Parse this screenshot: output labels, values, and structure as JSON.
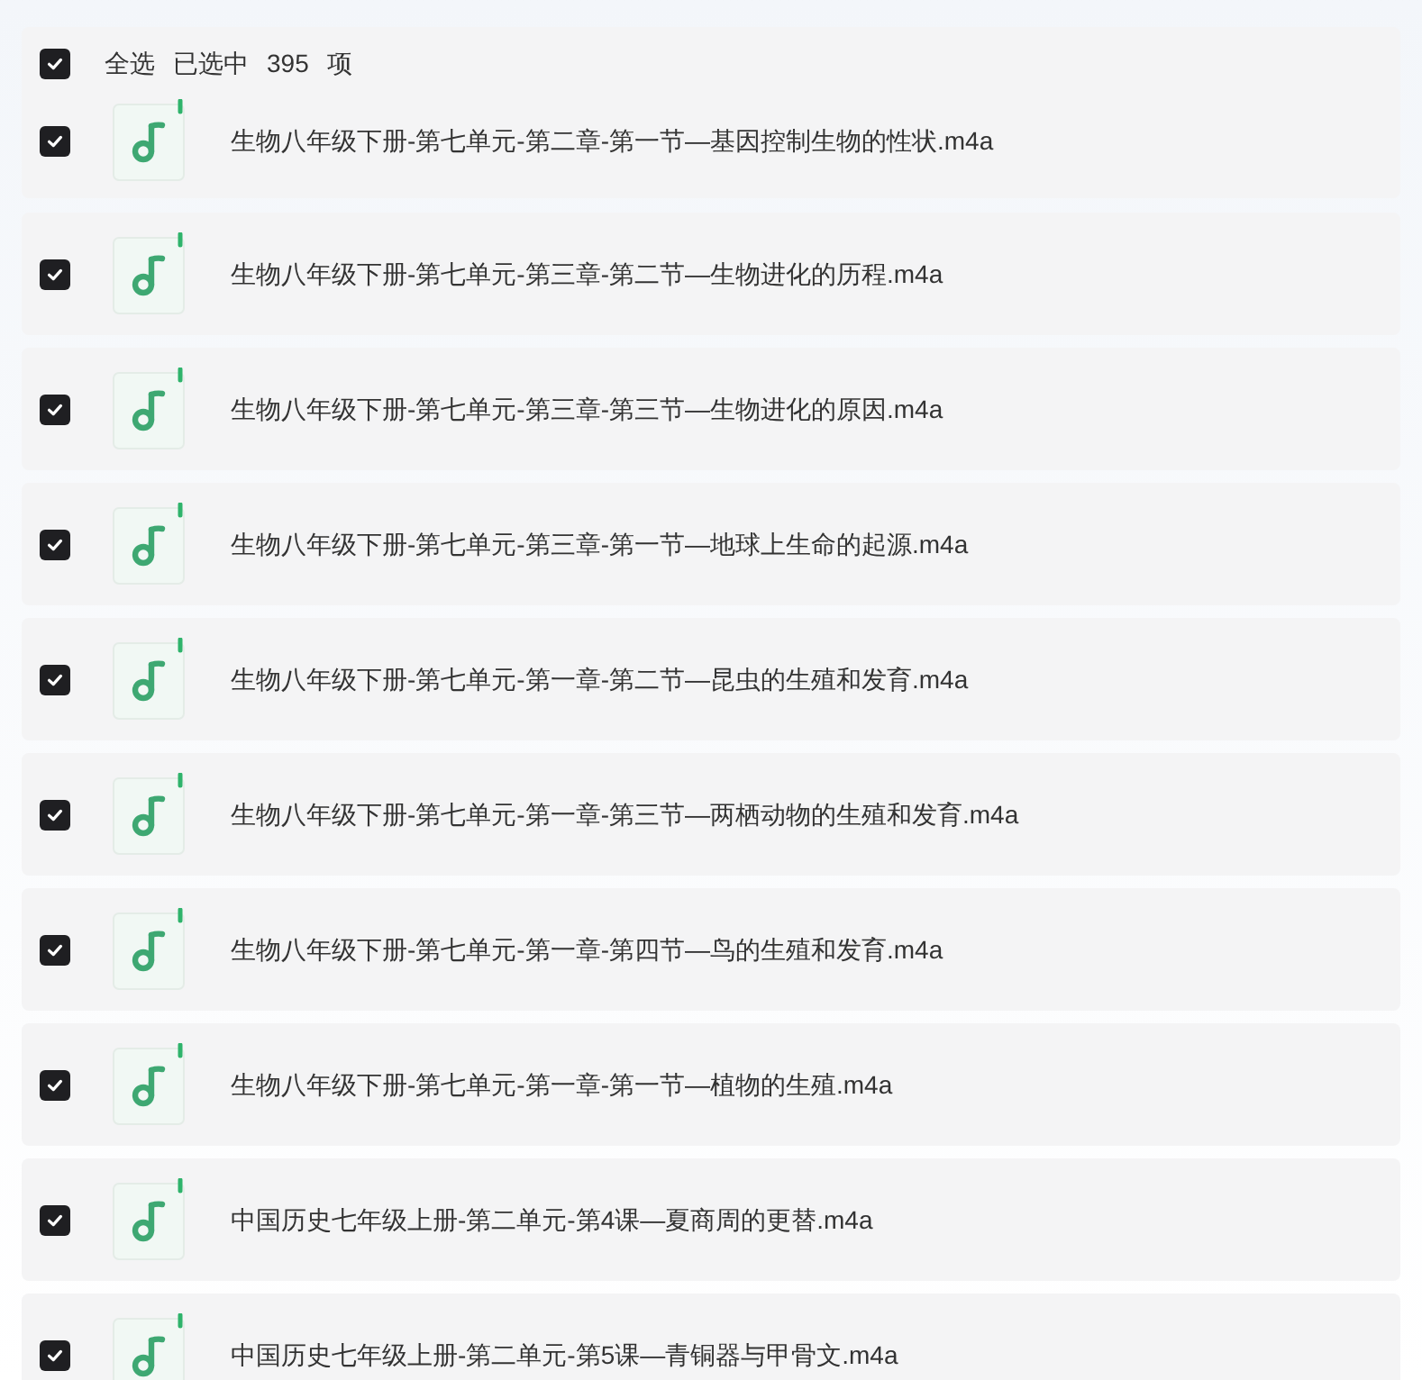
{
  "header": {
    "checked": true,
    "select_all": "全选",
    "selected_label": "已选中",
    "count": "395",
    "unit": "项"
  },
  "files": [
    {
      "name": "生物八年级下册-第七单元-第二章-第一节—基因控制生物的性状.m4a",
      "checked": true
    },
    {
      "name": "生物八年级下册-第七单元-第三章-第二节—生物进化的历程.m4a",
      "checked": true
    },
    {
      "name": "生物八年级下册-第七单元-第三章-第三节—生物进化的原因.m4a",
      "checked": true
    },
    {
      "name": "生物八年级下册-第七单元-第三章-第一节—地球上生命的起源.m4a",
      "checked": true
    },
    {
      "name": "生物八年级下册-第七单元-第一章-第二节—昆虫的生殖和发育.m4a",
      "checked": true
    },
    {
      "name": "生物八年级下册-第七单元-第一章-第三节—两栖动物的生殖和发育.m4a",
      "checked": true
    },
    {
      "name": "生物八年级下册-第七单元-第一章-第四节—鸟的生殖和发育.m4a",
      "checked": true
    },
    {
      "name": "生物八年级下册-第七单元-第一章-第一节—植物的生殖.m4a",
      "checked": true
    },
    {
      "name": "中国历史七年级上册-第二单元-第4课—夏商周的更替.m4a",
      "checked": true
    },
    {
      "name": "中国历史七年级上册-第二单元-第5课—青铜器与甲骨文.m4a",
      "checked": true
    }
  ]
}
